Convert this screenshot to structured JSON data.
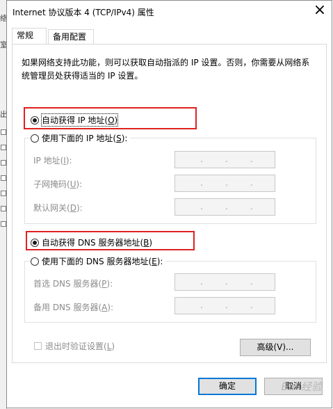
{
  "window": {
    "title": "Internet 协议版本 4 (TCP/IPv4) 属性"
  },
  "tabs": [
    {
      "label": "常规"
    },
    {
      "label": "备用配置"
    }
  ],
  "description": "如果网络支持此功能，则可以获取自动指派的 IP 设置。否则，你需要从网络系统管理员处获得适当的 IP 设置。",
  "ip_mode": {
    "auto": {
      "label": "自动获得 IP 地址(",
      "key": "O",
      "suffix": ")",
      "selected": true
    },
    "manual": {
      "label": "使用下面的 IP 地址(",
      "key": "S",
      "suffix": "):",
      "selected": false
    }
  },
  "ip_fields": [
    {
      "label": "IP 地址(",
      "key": "I",
      "suffix": "):",
      "value": ". . ."
    },
    {
      "label": "子网掩码(",
      "key": "U",
      "suffix": "):",
      "value": ". . ."
    },
    {
      "label": "默认网关(",
      "key": "D",
      "suffix": "):",
      "value": ". . ."
    }
  ],
  "dns_mode": {
    "auto": {
      "label": "自动获得 DNS 服务器地址(",
      "key": "B",
      "suffix": ")",
      "selected": true
    },
    "manual": {
      "label": "使用下面的 DNS 服务器地址(",
      "key": "E",
      "suffix": "):",
      "selected": false
    }
  },
  "dns_fields": [
    {
      "label": "首选 DNS 服务器(",
      "key": "P",
      "suffix": "):",
      "value": ". . ."
    },
    {
      "label": "备用 DNS 服务器(",
      "key": "A",
      "suffix": "):",
      "value": ". . ."
    }
  ],
  "validate": {
    "label": "退出时验证设置(",
    "key": "L",
    "suffix": ")",
    "checked": false
  },
  "buttons": {
    "advanced": "高级(V)...",
    "ok": "确定",
    "cancel": "取消"
  },
  "watermark": "Bai 经验",
  "colors": {
    "highlight": "#e02020",
    "focus": "#0078d7"
  },
  "background_glyphs": [
    "络",
    "室",
    "出"
  ]
}
